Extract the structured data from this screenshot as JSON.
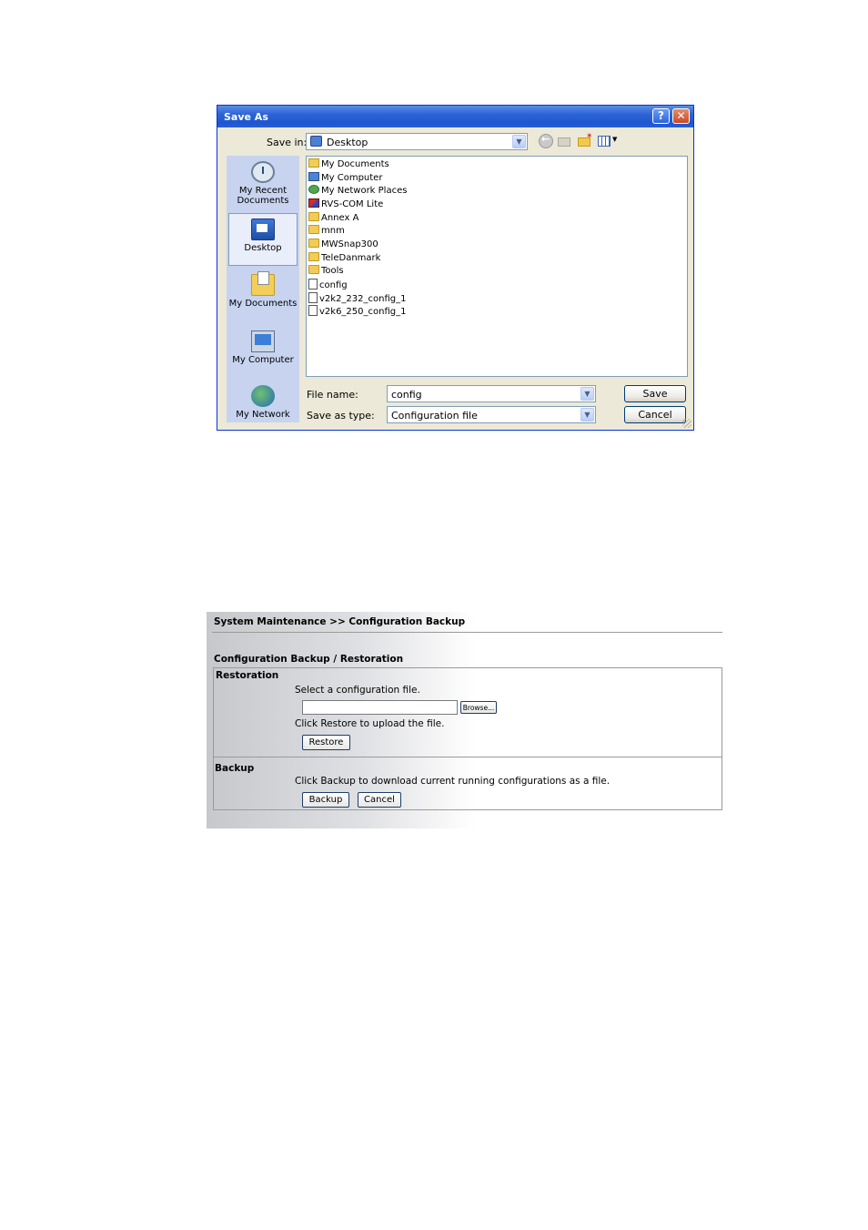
{
  "dialog": {
    "title": "Save As",
    "help_glyph": "?",
    "close_glyph": "✕",
    "save_in_label": "Save in:",
    "save_in_value": "Desktop",
    "places": [
      {
        "label": "My Recent Documents",
        "icon": "recent-documents-icon"
      },
      {
        "label": "Desktop",
        "icon": "desktop-icon"
      },
      {
        "label": "My Documents",
        "icon": "my-documents-icon"
      },
      {
        "label": "My Computer",
        "icon": "my-computer-icon"
      },
      {
        "label": "My Network",
        "icon": "my-network-icon"
      }
    ],
    "files": [
      {
        "name": "My Documents",
        "icon": "docs"
      },
      {
        "name": "My Computer",
        "icon": "comp"
      },
      {
        "name": "My Network Places",
        "icon": "net"
      },
      {
        "name": "RVS-COM Lite",
        "icon": "rvs"
      },
      {
        "name": "Annex A",
        "icon": "folder"
      },
      {
        "name": "mnm",
        "icon": "folder"
      },
      {
        "name": "MWSnap300",
        "icon": "folder"
      },
      {
        "name": "TeleDanmark",
        "icon": "folder"
      },
      {
        "name": "Tools",
        "icon": "folder"
      },
      {
        "name": "config",
        "icon": "doc"
      },
      {
        "name": "v2k2_232_config_1",
        "icon": "doc"
      },
      {
        "name": "v2k6_250_config_1",
        "icon": "doc"
      }
    ],
    "file_name_label": "File name:",
    "file_name_value": "config",
    "save_as_type_label": "Save as type:",
    "save_as_type_value": "Configuration file",
    "save_button": "Save",
    "cancel_button": "Cancel"
  },
  "panel": {
    "breadcrumb": "System Maintenance >> Configuration Backup",
    "section_title": "Configuration Backup / Restoration",
    "restoration_title": "Restoration",
    "select_text": "Select a configuration file.",
    "browse_button": "Browse...",
    "restore_hint": "Click Restore to upload the file.",
    "restore_button": "Restore",
    "backup_title": "Backup",
    "backup_hint": "Click Backup to download current running configurations as a file.",
    "backup_button": "Backup",
    "cancel_button": "Cancel"
  }
}
